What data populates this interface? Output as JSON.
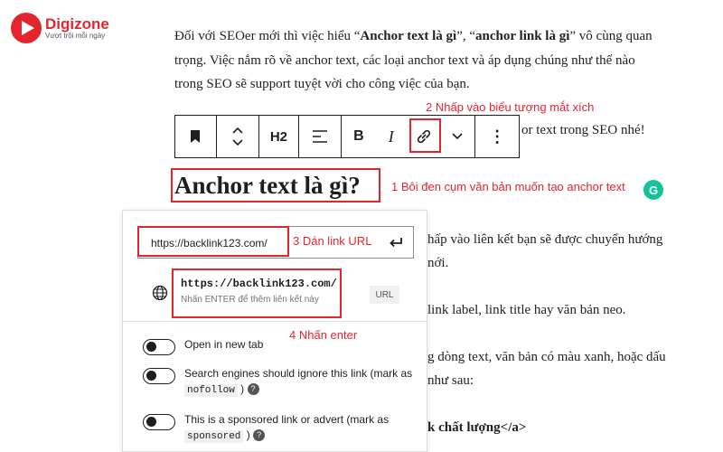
{
  "brand": {
    "name": "Digizone",
    "tagline": "Vượt trội mỗi ngày",
    "color": "#e3262e"
  },
  "article": {
    "para1": {
      "line1_a": "Đối với SEOer mới thì việc hiểu “",
      "line1_b": "Anchor text là gì",
      "line1_c": "”, “",
      "line1_d": "anchor link là gì",
      "line1_e": "” vô cùng quan",
      "line2": "trọng. Việc nắm rõ về anchor text, các loại anchor text và áp dụng chúng như thế nào",
      "line3": "trong SEO sẽ support tuyệt vời cho công việc của bạn."
    },
    "partial_line": "or text trong SEO nhé!",
    "heading": "Anchor text là gì?",
    "right_lines": [
      "hấp vào liên kết bạn sẽ được chuyển hướng",
      "nới.",
      "link label, link title hay văn bản neo.",
      "g dòng text, văn bản có màu xanh, hoặc dấu",
      "như sau:"
    ],
    "code_line": "k chất lượng</a>"
  },
  "annotations": {
    "step1": "1 Bôi đen cụm văn bản muốn tạo anchor text",
    "step2": "2 Nhấp vào biểu tượng mắt xích",
    "step3": "3 Dán link URL",
    "step4": "4 Nhấn enter"
  },
  "toolbar": {
    "heading_level": "H2",
    "bold": "B",
    "italic": "I",
    "more": "⋮"
  },
  "link_popover": {
    "url_value": "https://backlink123.com/",
    "suggestion_title": "https://backlink123.com/",
    "suggestion_hint": "Nhấn ENTER để thêm liên kết này",
    "suggestion_badge": "URL",
    "options": [
      {
        "label": "Open in new tab"
      },
      {
        "label_a": "Search engines should ignore this link (mark as ",
        "code": "nofollow",
        "label_b": " )"
      },
      {
        "label_a": "This is a sponsored link or advert (mark as ",
        "code": "sponsored",
        "label_b": " )"
      }
    ]
  },
  "icons": {
    "bookmark": "bookmark-icon",
    "move": "move-updown-icon",
    "align": "align-icon",
    "link": "link-icon",
    "chevron": "chevron-down-icon",
    "globe": "globe-icon",
    "enter": "enter-icon",
    "help": "help-icon",
    "grammarly": "grammarly-icon"
  }
}
